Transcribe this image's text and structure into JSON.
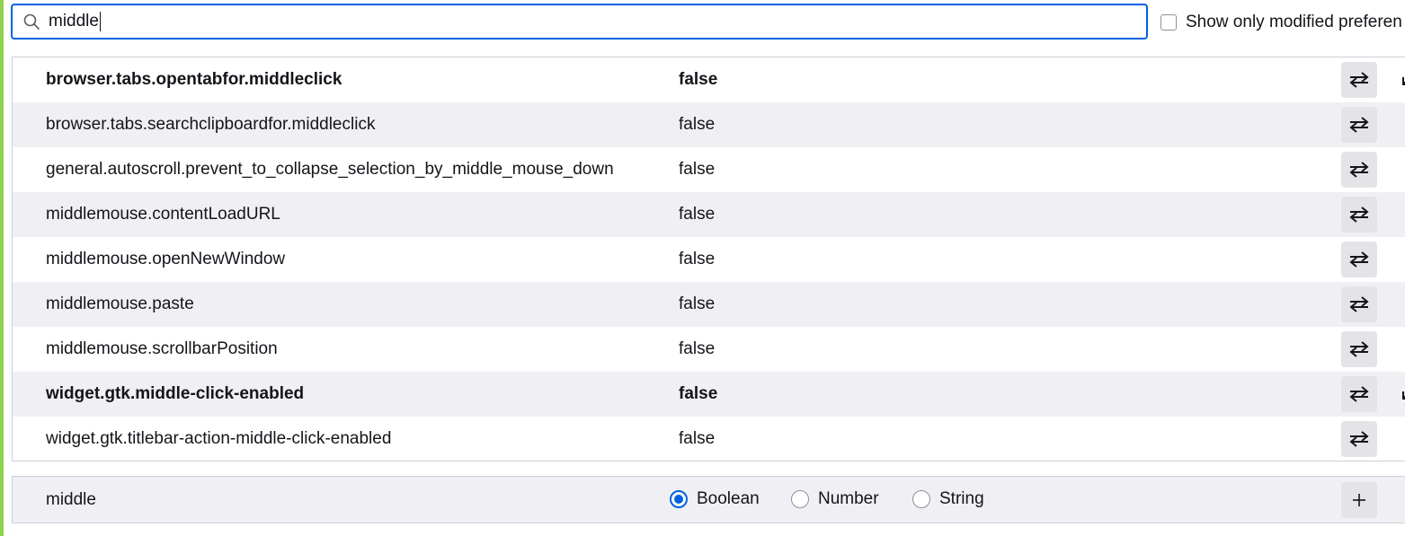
{
  "search": {
    "value": "middle"
  },
  "filter": {
    "show_modified_label": "Show only modified preferen"
  },
  "prefs": [
    {
      "name": "browser.tabs.opentabfor.middleclick",
      "value": "false",
      "modified": true
    },
    {
      "name": "browser.tabs.searchclipboardfor.middleclick",
      "value": "false",
      "modified": false
    },
    {
      "name": "general.autoscroll.prevent_to_collapse_selection_by_middle_mouse_down",
      "value": "false",
      "modified": false
    },
    {
      "name": "middlemouse.contentLoadURL",
      "value": "false",
      "modified": false
    },
    {
      "name": "middlemouse.openNewWindow",
      "value": "false",
      "modified": false
    },
    {
      "name": "middlemouse.paste",
      "value": "false",
      "modified": false
    },
    {
      "name": "middlemouse.scrollbarPosition",
      "value": "false",
      "modified": false
    },
    {
      "name": "widget.gtk.middle-click-enabled",
      "value": "false",
      "modified": true
    },
    {
      "name": "widget.gtk.titlebar-action-middle-click-enabled",
      "value": "false",
      "modified": false
    }
  ],
  "add_pref": {
    "name": "middle",
    "types": [
      {
        "label": "Boolean",
        "checked": true
      },
      {
        "label": "Number",
        "checked": false
      },
      {
        "label": "String",
        "checked": false
      }
    ]
  },
  "icons": {
    "search": "search-icon",
    "toggle": "toggle-icon",
    "reset": "reset-icon",
    "add": "plus-icon"
  },
  "colors": {
    "accent": "#0061e0",
    "row_alt": "#f0f0f4",
    "button_bg": "#e4e4e8",
    "left_strip": "#8fd14f"
  }
}
